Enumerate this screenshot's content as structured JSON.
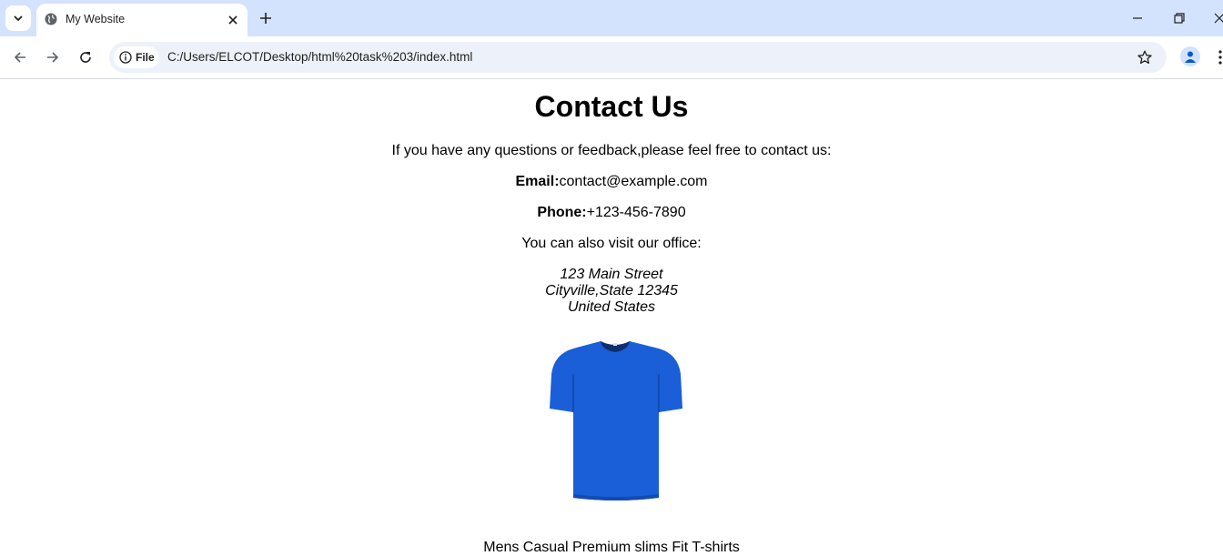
{
  "browser": {
    "tab_title": "My Website",
    "site_chip": "File",
    "url": "C:/Users/ELCOT/Desktop/html%20task%203/index.html"
  },
  "page": {
    "heading": "Contact Us",
    "intro": "If you have any questions or feedback,please feel free to contact us:",
    "email_label": "Email:",
    "email_value": "contact@example.com",
    "phone_label": "Phone:",
    "phone_value": "+123-456-7890",
    "visit_text": "You can also visit our office:",
    "address": [
      "123 Main Street",
      "Cityville,State 12345",
      "United States"
    ],
    "product_caption": "Mens Casual Premium slims Fit T-shirts"
  },
  "colors": {
    "tabstrip": "#d3e3fd",
    "omnibox": "#edf2fa",
    "shirt": "#1a5fd8"
  }
}
